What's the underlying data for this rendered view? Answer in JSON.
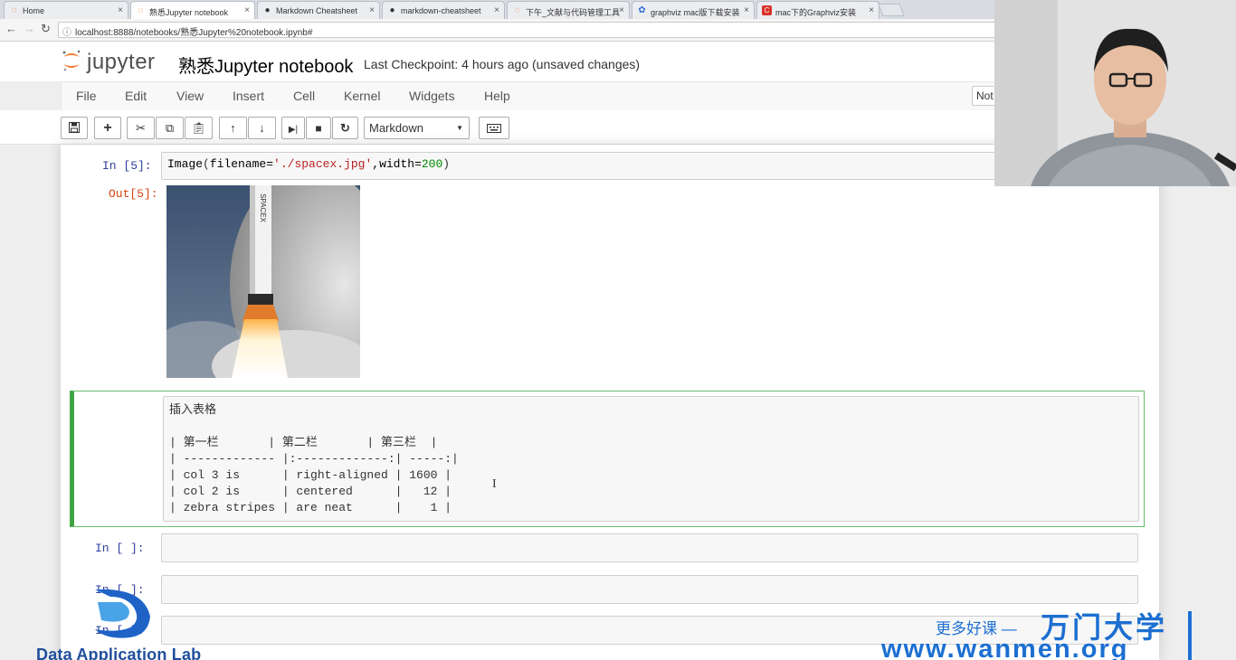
{
  "browser": {
    "tabs": [
      {
        "title": "Home",
        "icon": "jupyter-icon",
        "active": false
      },
      {
        "title": "熟悉Jupyter notebook",
        "icon": "jupyter-icon",
        "active": true
      },
      {
        "title": "Markdown Cheatsheet",
        "icon": "github-icon",
        "active": false
      },
      {
        "title": "markdown-cheatsheet",
        "icon": "github-icon",
        "active": false
      },
      {
        "title": "下午_文献与代码管理工具",
        "icon": "jupyter-icon",
        "active": false
      },
      {
        "title": "graphviz mac版下载安装",
        "icon": "baidu-icon",
        "active": false
      },
      {
        "title": "mac下的Graphviz安装",
        "icon": "csdn-icon",
        "active": false
      }
    ],
    "close_glyph": "×",
    "url": "localhost:8888/notebooks/熟悉Jupyter%20notebook.ipynb#"
  },
  "header": {
    "logo_text": "jupyter",
    "notebook_name": "熟悉Jupyter notebook",
    "checkpoint": "Last Checkpoint: 4 hours ago (unsaved changes)",
    "kernel_indicator": "Not"
  },
  "menu": {
    "items": [
      "File",
      "Edit",
      "View",
      "Insert",
      "Cell",
      "Kernel",
      "Widgets",
      "Help"
    ]
  },
  "toolbar": {
    "buttons": [
      "save-icon",
      "plus-icon",
      "scissors-icon",
      "copy-icon",
      "paste-icon",
      "arrow-up-icon",
      "arrow-down-icon",
      "step-forward-icon",
      "stop-icon",
      "restart-icon",
      "keyboard-icon"
    ],
    "cell_type": "Markdown"
  },
  "cells": {
    "code_cell": {
      "in_prompt": "In  [5]:",
      "code_fn": "Image",
      "code_kw": "filename=",
      "code_str": "'./spacex.jpg'",
      "code_kw2": ",width=",
      "code_num": "200",
      "out_prompt": "Out[5]:"
    },
    "markdown_cell": {
      "lines": [
        "插入表格",
        "",
        "| 第一栏       | 第二栏       | 第三栏  |",
        "| ------------- |:-------------:| -----:|",
        "| col 3 is      | right-aligned | 1600 |",
        "| col 2 is      | centered      |   12 |",
        "| zebra stripes | are neat      |    1 |"
      ]
    },
    "empty_prompts": [
      "In  [ ]:",
      "In  [ ]:",
      "In  [ ]:"
    ]
  },
  "watermark": {
    "left_text": "Data Application Lab",
    "slogan": "更多好课 —",
    "brand": "万门大学",
    "url": "www.wanmen.org"
  },
  "colors": {
    "jupyter_orange": "#f37726",
    "prompt_in": "#303f9f",
    "prompt_out": "#d84315",
    "edit_border": "#66bb6a",
    "watermark_blue": "#1c6fd1"
  }
}
